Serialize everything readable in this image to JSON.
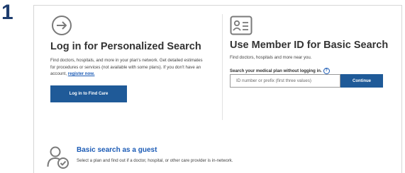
{
  "step_number": "1",
  "login": {
    "title": "Log in for Personalized Search",
    "description": "Find doctors, hospitals, and more in your plan's network. Get detailed estimates for procedures or services (not available with some plans). If you don't have an account,",
    "register_link": "register now.",
    "button_label": "Log in to Find Care",
    "icon": "login-arrow-icon"
  },
  "member_id": {
    "title": "Use Member ID for Basic Search",
    "description": "Find doctors, hospitals and more near you.",
    "search_label": "Search your medical plan without logging in.",
    "input_placeholder": "ID number or prefix (first three values)",
    "input_value": "",
    "continue_label": "Continue",
    "icon": "id-card-icon"
  },
  "guest": {
    "title": "Basic search as a guest",
    "description": "Select a plan and find out if a doctor, hospital, or other care provider is in-network.",
    "icon": "guest-user-check-icon"
  },
  "colors": {
    "primary_button": "#1f5a98",
    "link": "#1a5ab5",
    "step_number": "#1d3c6e",
    "icon_gray": "#7a7a7a"
  }
}
